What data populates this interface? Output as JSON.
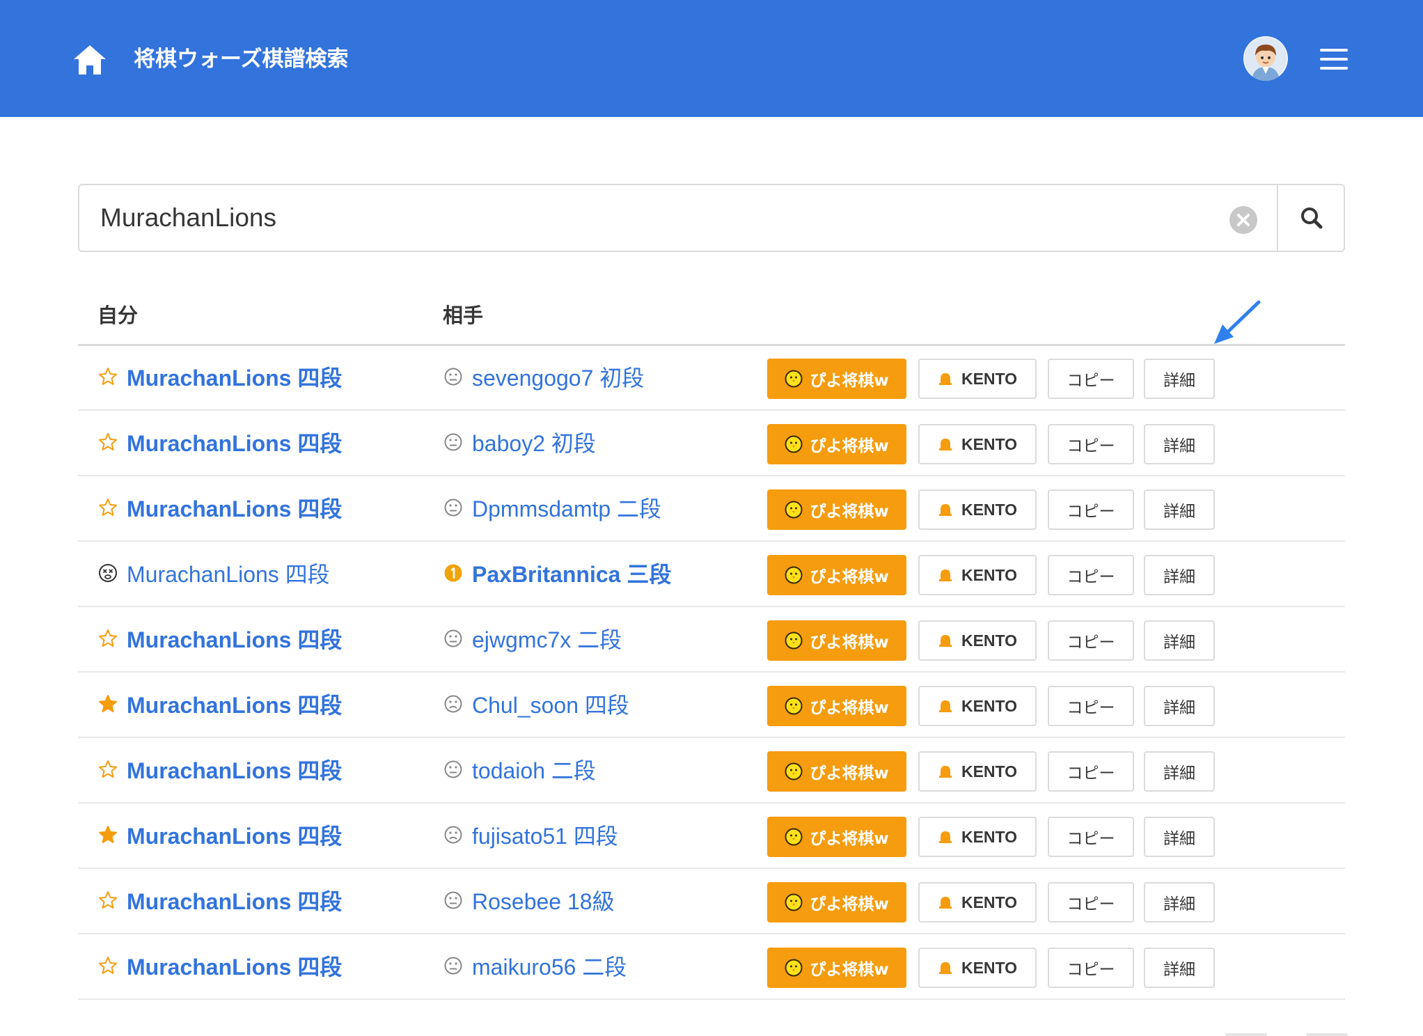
{
  "header": {
    "title": "将棋ウォーズ棋譜検索"
  },
  "search": {
    "value": "MurachanLions"
  },
  "table": {
    "col_self": "自分",
    "col_opponent": "相手",
    "buttons": {
      "piyo": "ぴよ将棋w",
      "kento": "KENTO",
      "copy": "コピー",
      "detail": "詳細"
    },
    "rows": [
      {
        "self_icon": "star-outline-icon",
        "self": "MurachanLions 四段",
        "self_bold": true,
        "opp_icon": "neutral-face-icon",
        "opponent": "sevengogo7 初段",
        "opp_bold": false
      },
      {
        "self_icon": "star-outline-icon",
        "self": "MurachanLions 四段",
        "self_bold": true,
        "opp_icon": "neutral-face-icon",
        "opponent": "baboy2 初段",
        "opp_bold": false
      },
      {
        "self_icon": "star-outline-icon",
        "self": "MurachanLions 四段",
        "self_bold": true,
        "opp_icon": "neutral-face-icon",
        "opponent": "Dpmmsdamtp 二段",
        "opp_bold": false
      },
      {
        "self_icon": "dizzy-face-icon",
        "self": "MurachanLions 四段",
        "self_bold": false,
        "opp_icon": "first-badge-icon",
        "opponent": "PaxBritannica 三段",
        "opp_bold": true
      },
      {
        "self_icon": "star-outline-icon",
        "self": "MurachanLions 四段",
        "self_bold": true,
        "opp_icon": "neutral-face-icon",
        "opponent": "ejwgmc7x 二段",
        "opp_bold": false
      },
      {
        "self_icon": "star-filled-icon",
        "self": "MurachanLions 四段",
        "self_bold": true,
        "opp_icon": "sad-face-icon",
        "opponent": "Chul_soon 四段",
        "opp_bold": false
      },
      {
        "self_icon": "star-outline-icon",
        "self": "MurachanLions 四段",
        "self_bold": true,
        "opp_icon": "neutral-face-icon",
        "opponent": "todaioh 二段",
        "opp_bold": false
      },
      {
        "self_icon": "star-filled-icon",
        "self": "MurachanLions 四段",
        "self_bold": true,
        "opp_icon": "sad-face-icon",
        "opponent": "fujisato51 四段",
        "opp_bold": false
      },
      {
        "self_icon": "star-outline-icon",
        "self": "MurachanLions 四段",
        "self_bold": true,
        "opp_icon": "neutral-face-icon",
        "opponent": "Rosebee 18級",
        "opp_bold": false
      },
      {
        "self_icon": "star-outline-icon",
        "self": "MurachanLions 四段",
        "self_bold": true,
        "opp_icon": "neutral-face-icon",
        "opponent": "maikuro56 二段",
        "opp_bold": false
      }
    ]
  },
  "colors": {
    "header": "#3273dc",
    "link": "#3273dc",
    "piyo_button": "#f59c0f",
    "star": "#f59c0f",
    "annotation_arrow": "#2f80ed"
  }
}
